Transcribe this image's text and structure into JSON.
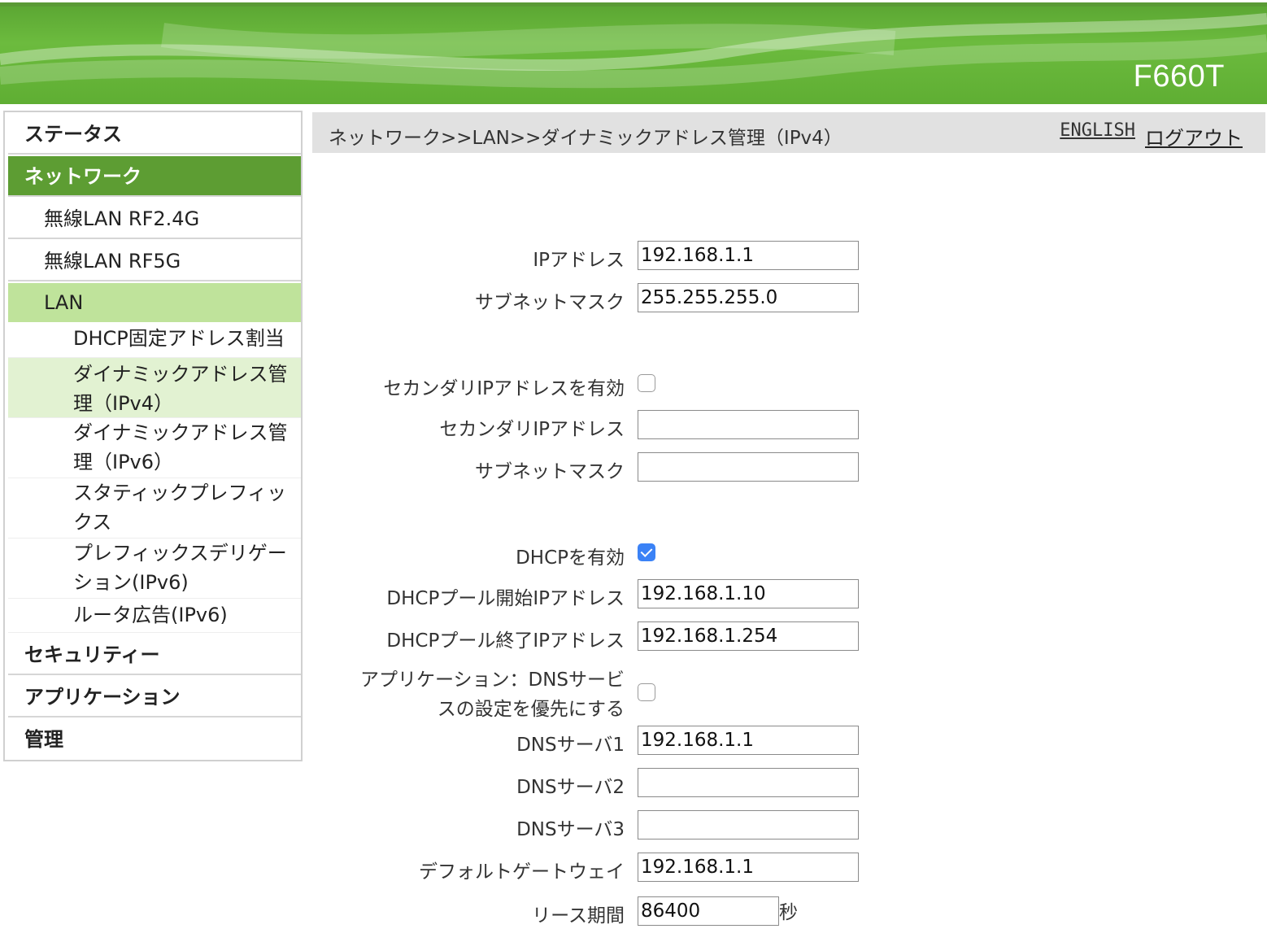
{
  "header": {
    "model": "F660T"
  },
  "sidebar": {
    "status": "ステータス",
    "network": "ネットワーク",
    "wifi24": "無線LAN RF2.4G",
    "wifi5": "無線LAN RF5G",
    "lan": "LAN",
    "lan_items": [
      "DHCP固定アドレス割当",
      "ダイナミックアドレス管",
      "理（IPv4）",
      "ダイナミックアドレス管",
      "理（IPv6）",
      "スタティックプレフィッ",
      "クス",
      "プレフィックスデリゲー",
      "ション(IPv6)",
      "ルータ広告(IPv6)"
    ],
    "security": "セキュリティー",
    "application": "アプリケーション",
    "admin": "管理"
  },
  "topbar": {
    "breadcrumb": "ネットワーク>>LAN>>ダイナミックアドレス管理（IPv4）",
    "english": "ENGLISH",
    "logout": "ログアウト"
  },
  "form": {
    "ip_label": "IPアドレス",
    "ip_value": "192.168.1.1",
    "mask_label": "サブネットマスク",
    "mask_value": "255.255.255.0",
    "secondary_enable_label": "セカンダリIPアドレスを有効",
    "secondary_enable": false,
    "secondary_ip_label": "セカンダリIPアドレス",
    "secondary_ip_value": "",
    "secondary_mask_label": "サブネットマスク",
    "secondary_mask_value": "",
    "dhcp_enable_label": "DHCPを有効",
    "dhcp_enable": true,
    "pool_start_label": "DHCPプール開始IPアドレス",
    "pool_start_value": "192.168.1.10",
    "pool_end_label": "DHCPプール終了IPアドレス",
    "pool_end_value": "192.168.1.254",
    "app_dns_label_1": "アプリケーション：DNSサービ",
    "app_dns_label_2": "スの設定を優先にする",
    "app_dns": false,
    "dns1_label": "DNSサーバ1",
    "dns1_value": "192.168.1.1",
    "dns2_label": "DNSサーバ2",
    "dns2_value": "",
    "dns3_label": "DNSサーバ3",
    "dns3_value": "",
    "gateway_label": "デフォルトゲートウェイ",
    "gateway_value": "192.168.1.1",
    "lease_label": "リース期間",
    "lease_value": "86400",
    "lease_unit": "秒"
  },
  "colors": {
    "brand_green": "#5fae33",
    "nav_active": "#5d9d33",
    "nav_sub_active": "#bfe39b",
    "checkbox_checked": "#3b82f6"
  }
}
